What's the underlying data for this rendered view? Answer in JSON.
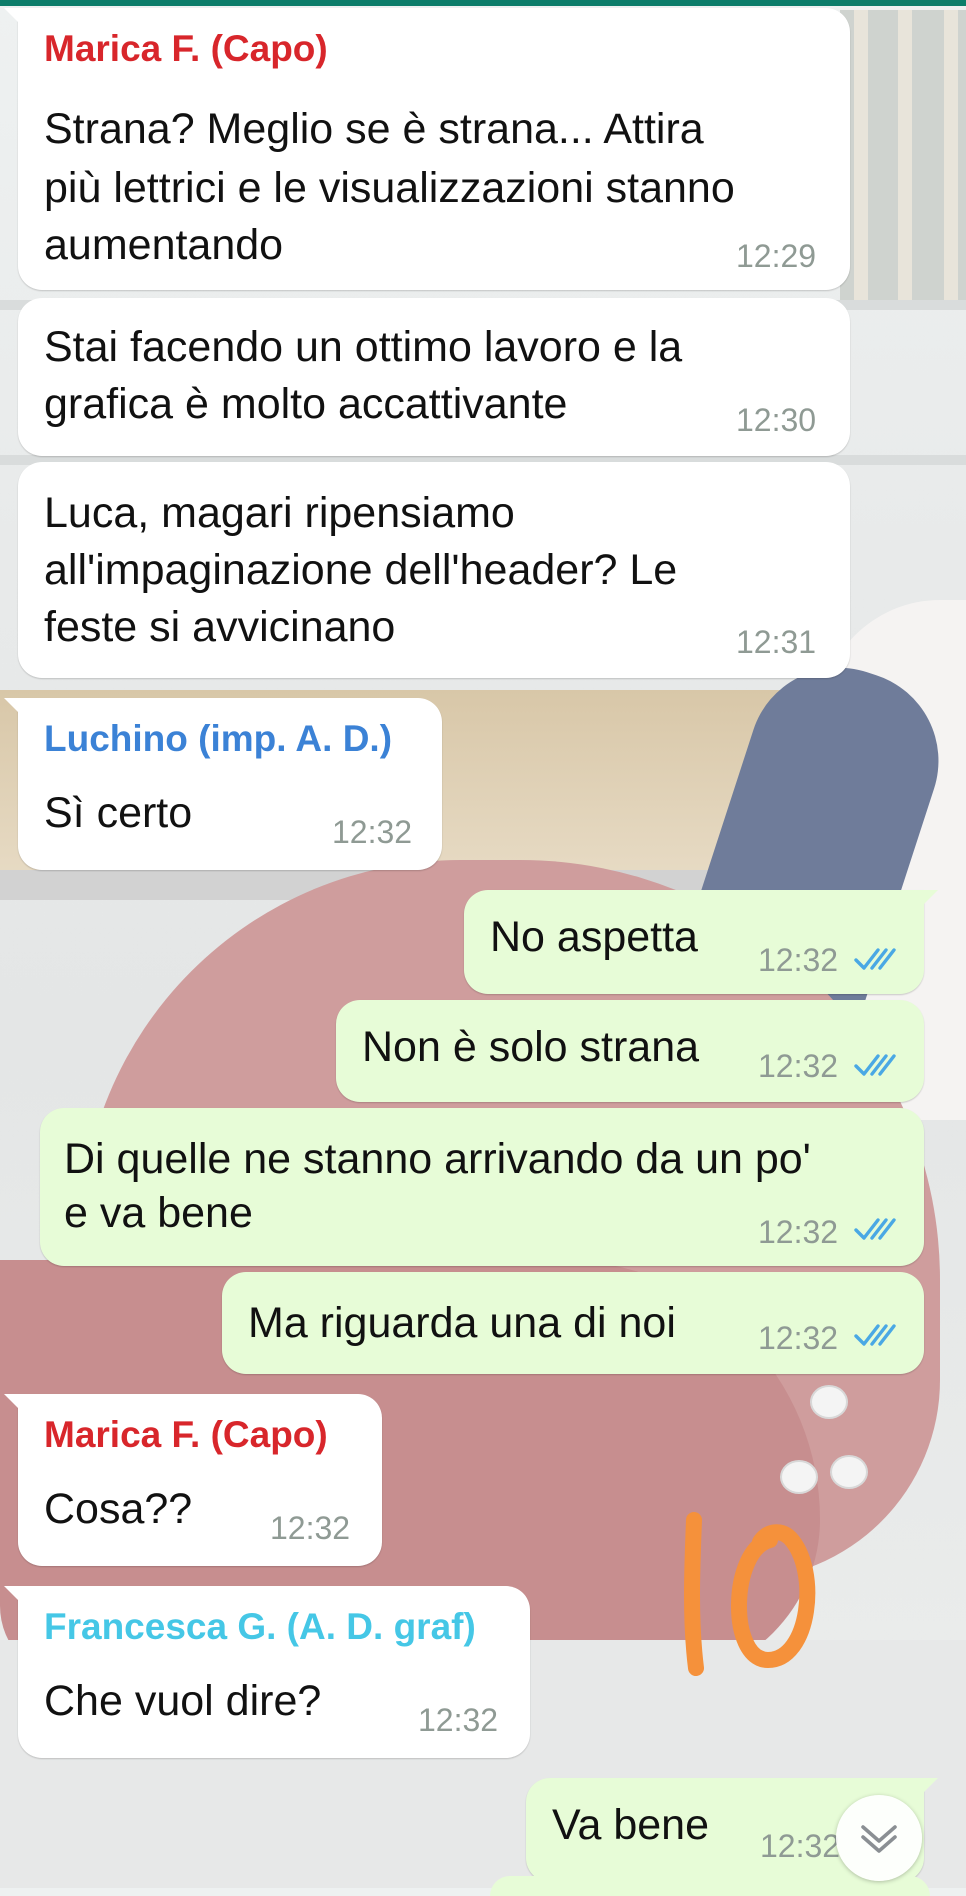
{
  "colors": {
    "incoming_bg": "#ffffff",
    "outgoing_bg": "#e7fcd7",
    "time": "#8f9a94",
    "tick_read": "#4aa8e4",
    "name_marica": "#d8262b",
    "name_luchino": "#3b82d6",
    "name_francesca": "#45c7e6",
    "annotation": "#f5913b"
  },
  "messages": [
    {
      "direction": "in",
      "sender": "Marica F. (Capo)",
      "lines": [
        "Strana? Meglio se è strana... Attira",
        "più lettrici e le visualizzazioni stanno",
        "aumentando"
      ],
      "time": "12:29"
    },
    {
      "direction": "in",
      "lines": [
        "Stai facendo un ottimo lavoro e la",
        "grafica è molto accattivante"
      ],
      "time": "12:30"
    },
    {
      "direction": "in",
      "lines": [
        "Luca, magari ripensiamo",
        "all'impaginazione dell'header? Le",
        "feste si avvicinano"
      ],
      "time": "12:31"
    },
    {
      "direction": "in",
      "sender": "Luchino (imp. A. D.)",
      "lines": [
        "Sì certo"
      ],
      "time": "12:32"
    },
    {
      "direction": "out",
      "lines": [
        "No aspetta"
      ],
      "time": "12:32",
      "status": "read"
    },
    {
      "direction": "out",
      "lines": [
        "Non è solo strana"
      ],
      "time": "12:32",
      "status": "read"
    },
    {
      "direction": "out",
      "lines": [
        "Di quelle ne stanno arrivando da un po'",
        "e va bene"
      ],
      "time": "12:32",
      "status": "read"
    },
    {
      "direction": "out",
      "lines": [
        "Ma riguarda una di noi"
      ],
      "time": "12:32",
      "status": "read"
    },
    {
      "direction": "in",
      "sender": "Marica F. (Capo)",
      "lines": [
        "Cosa??"
      ],
      "time": "12:32"
    },
    {
      "direction": "in",
      "sender": "Francesca G. (A. D. graf)",
      "lines": [
        "Che vuol dire?"
      ],
      "time": "12:32"
    },
    {
      "direction": "out",
      "lines": [
        "Va bene"
      ],
      "time": "12:32"
    }
  ],
  "icons": {
    "read_ticks": "double-check-icon",
    "scroll_down": "chevron-down-icon",
    "annotation": "handwritten-10"
  }
}
